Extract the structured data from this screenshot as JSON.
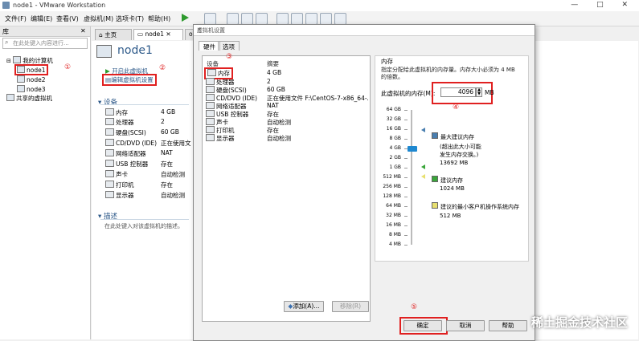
{
  "window": {
    "title": "node1 - VMware Workstation",
    "controls": "—  □  ✕"
  },
  "menu": [
    "文件(F)",
    "编辑(E)",
    "查看(V)",
    "虚拟机(M)",
    "选项卡(T)",
    "帮助(H)"
  ],
  "library": {
    "title": "库",
    "search_placeholder": "在此处键入内容进行...",
    "tree": {
      "root": "我的计算机",
      "vms": [
        "node1",
        "node2",
        "node3"
      ],
      "shared": "共享的虚拟机"
    }
  },
  "tabs": [
    "主页",
    "node1",
    "o"
  ],
  "vm": {
    "name": "node1",
    "actions": {
      "power_on": "开启此虚拟机",
      "edit_settings": "编辑虚拟机设置"
    },
    "devices_header": "设备",
    "devices": [
      {
        "name": "内存",
        "value": "4 GB"
      },
      {
        "name": "处理器",
        "value": "2"
      },
      {
        "name": "硬盘(SCSI)",
        "value": "60 GB"
      },
      {
        "name": "CD/DVD (IDE)",
        "value": "正在使用文"
      },
      {
        "name": "网络适配器",
        "value": "NAT"
      },
      {
        "name": "USB 控制器",
        "value": "存在"
      },
      {
        "name": "声卡",
        "value": "自动检测"
      },
      {
        "name": "打印机",
        "value": "存在"
      },
      {
        "name": "显示器",
        "value": "自动检测"
      }
    ],
    "desc_header": "描述",
    "desc_text": "在此处键入对该虚拟机的描述。"
  },
  "dialog": {
    "title": "虚拟机设置",
    "tabs": [
      "硬件",
      "选项"
    ],
    "list_headers": {
      "device": "设备",
      "summary": "摘要"
    },
    "devices": [
      {
        "name": "内存",
        "summary": "4 GB"
      },
      {
        "name": "处理器",
        "summary": "2"
      },
      {
        "name": "硬盘(SCSI)",
        "summary": "60 GB"
      },
      {
        "name": "CD/DVD (IDE)",
        "summary": "正在使用文件 F:\\CentOS-7-x86_64-..."
      },
      {
        "name": "网络适配器",
        "summary": "NAT"
      },
      {
        "name": "USB 控制器",
        "summary": "存在"
      },
      {
        "name": "声卡",
        "summary": "自动检测"
      },
      {
        "name": "打印机",
        "summary": "存在"
      },
      {
        "name": "显示器",
        "summary": "自动检测"
      }
    ],
    "add_button": "添加(A)...",
    "remove_button": "移除(R)",
    "memory": {
      "group_label": "内存",
      "desc_line1": "指定分配给此虚拟机的内存量。内存大小必须为 4 MB",
      "desc_line2": "的倍数。",
      "field_label": "此虚拟机的内存(M):",
      "value": "4096",
      "unit": "MB",
      "scale": [
        "64 GB",
        "32 GB",
        "16 GB",
        "8 GB",
        "4 GB",
        "2 GB",
        "1 GB",
        "512 MB",
        "256 MB",
        "128 MB",
        "64 MB",
        "32 MB",
        "16 MB",
        "8 MB",
        "4 MB"
      ],
      "legend": {
        "max_title": "最大建议内存",
        "max_note1": "(超出此大小可能",
        "max_note2": "发生内存交换。)",
        "max_value": "13692 MB",
        "rec_title": "建议内存",
        "rec_value": "1024 MB",
        "min_title": "建议的最小客户机操作系统内存",
        "min_value": "512 MB"
      },
      "colors": {
        "max": "#4a7fb0",
        "rec": "#3aa63a",
        "min": "#e8e070",
        "slider": "#1e88d0"
      }
    },
    "buttons": {
      "ok": "确定",
      "cancel": "取消",
      "help": "帮助"
    }
  },
  "annotations": [
    "①",
    "②",
    "③",
    "④",
    "⑤"
  ],
  "watermark": "稀土掘金技术社区"
}
